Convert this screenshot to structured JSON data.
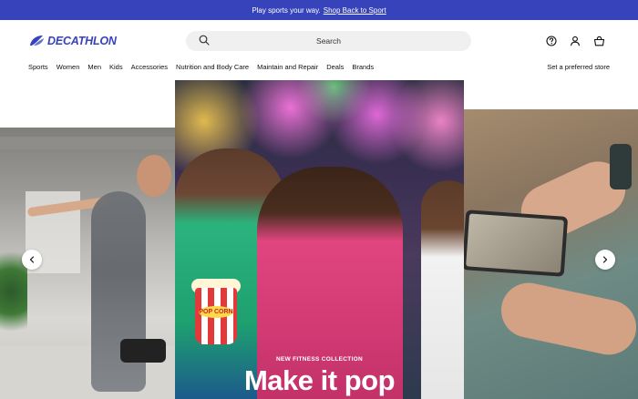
{
  "promo": {
    "text": "Play sports your way.",
    "link": "Shop Back to Sport"
  },
  "header": {
    "logo": "DECATHLON",
    "search_placeholder": "Search",
    "icons": [
      "help-icon",
      "account-icon",
      "cart-icon"
    ]
  },
  "nav": {
    "items": [
      "Sports",
      "Women",
      "Men",
      "Kids",
      "Accessories",
      "Nutrition and Body Care",
      "Maintain and Repair",
      "Deals",
      "Brands"
    ],
    "store_link": "Set a preferred store"
  },
  "hero": {
    "eyebrow": "NEW FITNESS COLLECTION",
    "headline": "Make it pop",
    "popcorn_label": "POP CORN"
  },
  "colors": {
    "brand": "#3643ba",
    "promo_bg": "#3643ba",
    "search_bg": "#f0f0f1"
  }
}
